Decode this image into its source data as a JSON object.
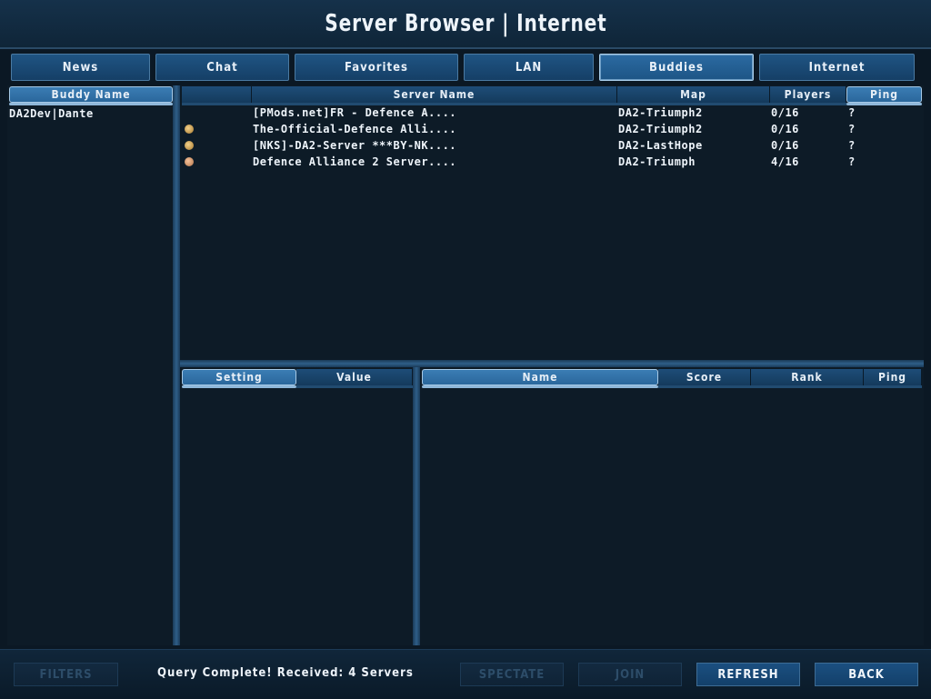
{
  "window": {
    "title": "Server Browser | Internet"
  },
  "tabs": [
    {
      "label": "News",
      "active": false
    },
    {
      "label": "Chat",
      "active": false
    },
    {
      "label": "Favorites",
      "active": false
    },
    {
      "label": "LAN",
      "active": false
    },
    {
      "label": "Buddies",
      "active": true
    },
    {
      "label": "Internet",
      "active": false
    }
  ],
  "buddies": {
    "header": "Buddy Name",
    "items": [
      "DA2Dev|Dante"
    ]
  },
  "servers": {
    "headers": {
      "icon": "",
      "name": "Server Name",
      "map": "Map",
      "players": "Players",
      "ping": "Ping"
    },
    "rows": [
      {
        "icon": "",
        "name": "[PMods.net]FR - Defence A....",
        "map": "DA2-Triumph2",
        "players": "0/16",
        "ping": "?"
      },
      {
        "icon": "status-orange-icon",
        "name": "The-Official-Defence Alli....",
        "map": "DA2-Triumph2",
        "players": "0/16",
        "ping": "?"
      },
      {
        "icon": "status-orange-icon",
        "name": "[NKS]-DA2-Server ***BY-NK....",
        "map": "DA2-LastHope",
        "players": "0/16",
        "ping": "?"
      },
      {
        "icon": "status-peach-icon",
        "name": "Defence Alliance 2 Server....",
        "map": "DA2-Triumph",
        "players": "4/16",
        "ping": "?"
      }
    ]
  },
  "settings": {
    "headers": {
      "setting": "Setting",
      "value": "Value"
    }
  },
  "players": {
    "headers": {
      "name": "Name",
      "score": "Score",
      "rank": "Rank",
      "ping": "Ping"
    }
  },
  "bottom": {
    "filters_label": "FILTERS",
    "status_text": "Query Complete! Received: 4 Servers",
    "spectate_label": "SPECTATE",
    "join_label": "JOIN",
    "refresh_label": "REFRESH",
    "back_label": "BACK"
  },
  "colors": {
    "accent": "#1d5586",
    "background": "#0d1b27",
    "icon_orange": "#c8a050",
    "icon_peach": "#d69a6a"
  }
}
